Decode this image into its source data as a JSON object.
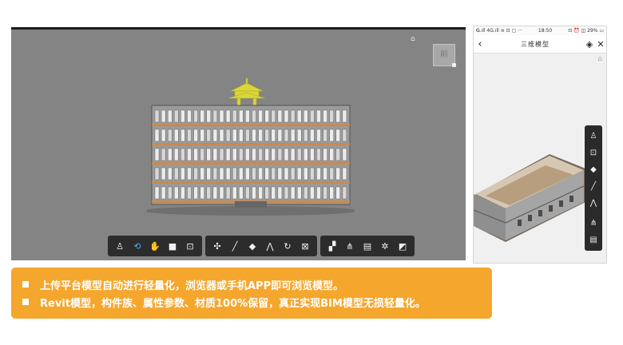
{
  "desktop_viewer": {
    "viewcube_label": "前",
    "home_icon": "home-icon",
    "toolbar_groups": [
      [
        "person-icon",
        "orbit-icon",
        "pan-hand-icon",
        "camera-icon",
        "zoom-box-icon"
      ],
      [
        "explode-icon",
        "measure-icon",
        "cube-icon",
        "section-icon",
        "rotate-icon",
        "fullscreen-icon"
      ],
      [
        "model-tree-icon",
        "hierarchy-icon",
        "properties-icon",
        "settings-icon",
        "expand-icon"
      ]
    ],
    "active_tool": "orbit-icon"
  },
  "mobile_viewer": {
    "status_left": "𝐆.ıll 4G.ıll ≋ ⊡ ▢ ···",
    "status_time": "18:50",
    "status_right": "⊡ ⏰ ◫ 29% ▭",
    "title": "三维模型",
    "tools": [
      "person-icon",
      "zoom-icon",
      "cube-icon",
      "measure-icon",
      "section-icon",
      "hierarchy-icon",
      "properties-icon"
    ]
  },
  "banner": {
    "line1": "上传平台模型自动进行轻量化，浏览器或手机APP即可浏览模型。",
    "line2": "Revit模型，构件族、属性参数、材质100%保留，真正实现BIM模型无损轻量化。",
    "color": "#f5a62d"
  }
}
